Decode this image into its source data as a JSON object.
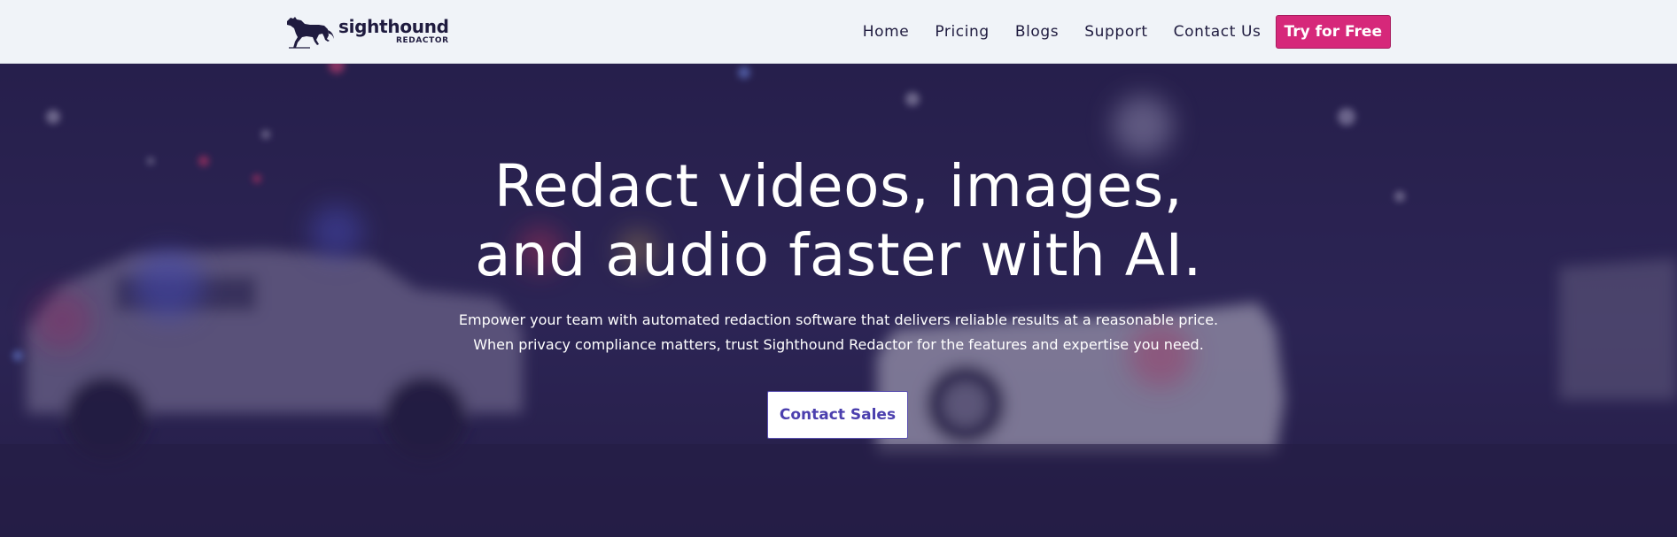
{
  "brand": {
    "name": "sighthound",
    "sub": "REDACTOR",
    "color": "#1f1b3f"
  },
  "nav": {
    "items": [
      {
        "label": "Home"
      },
      {
        "label": "Pricing"
      },
      {
        "label": "Blogs"
      },
      {
        "label": "Support"
      },
      {
        "label": "Contact Us"
      }
    ],
    "cta_label": "Try for Free",
    "cta_color": "#d6287a"
  },
  "hero": {
    "title_line1": "Redact videos, images,",
    "title_line2": "and audio faster with AI.",
    "sub_line1": "Empower your team with automated redaction software that delivers reliable results at a reasonable price.",
    "sub_line2": "When privacy compliance matters, trust Sighthound Redactor for the features and expertise you need.",
    "cta_label": "Contact Sales",
    "overlay_color": "#2a2352"
  }
}
